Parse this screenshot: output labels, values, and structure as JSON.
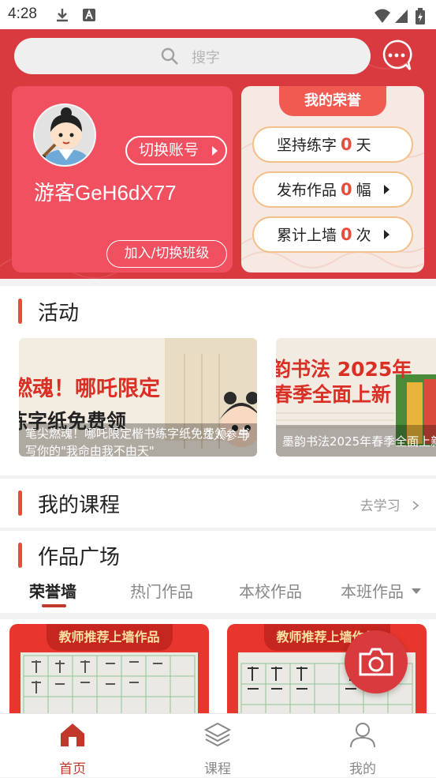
{
  "status_bar": {
    "time": "4:28"
  },
  "search": {
    "placeholder": "搜字"
  },
  "user": {
    "username": "游客GeH6dX77",
    "switch_account": "切换账号",
    "join_class": "加入/切换班级"
  },
  "honors": {
    "title": "我的荣誉",
    "rows": [
      {
        "prefix": "坚持练字",
        "value": "0",
        "unit": "天"
      },
      {
        "prefix": "发布作品",
        "value": "0",
        "unit": "幅"
      },
      {
        "prefix": "累计上墙",
        "value": "0",
        "unit": "次"
      }
    ]
  },
  "activities": {
    "title": "活动",
    "banners": [
      {
        "headline1": "燃魂！哪吒限定",
        "headline2": "练字纸免费领",
        "caption": "笔尖燃魂！哪吒限定楷书练字纸免费领，书写你的\"我命由我不由天\"",
        "participants": "1人参与"
      },
      {
        "headline1": "韵书法 2025年",
        "headline2": "春季全面上新",
        "caption": "墨韵书法2025年春季全面上新"
      }
    ]
  },
  "courses": {
    "title": "我的课程",
    "go_learn": "去学习"
  },
  "works": {
    "title": "作品广场",
    "tabs": [
      "荣誉墙",
      "热门作品",
      "本校作品",
      "本班作品"
    ],
    "cards": [
      {
        "ribbon": "教师推荐上墙作品"
      },
      {
        "ribbon": "教师推荐上墙作品"
      }
    ]
  },
  "bottom_nav": {
    "items": [
      {
        "label": "首页"
      },
      {
        "label": "课程"
      },
      {
        "label": "我的"
      }
    ]
  },
  "colors": {
    "brand_red": "#d83a40",
    "accent_red": "#e74c3c"
  }
}
